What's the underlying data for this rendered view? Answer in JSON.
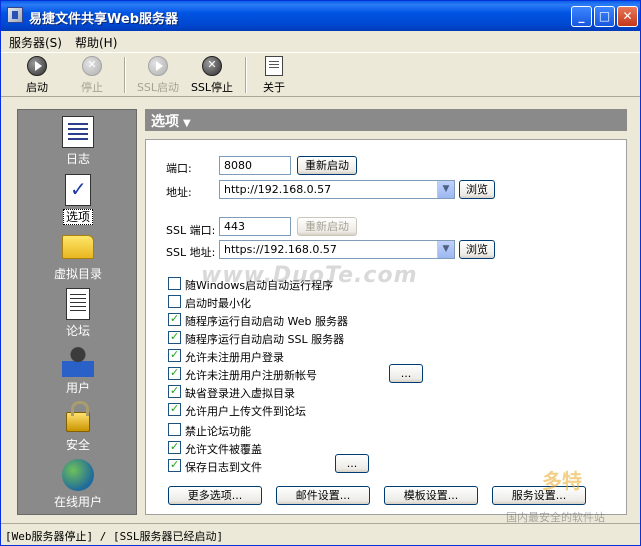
{
  "window": {
    "title": "易捷文件共享Web服务器"
  },
  "menu": [
    {
      "label": "服务器(S)"
    },
    {
      "label": "帮助(H)"
    }
  ],
  "toolbar": [
    {
      "label": "启动",
      "icon": "start-icon",
      "enabled": true
    },
    {
      "label": "停止",
      "icon": "stop-icon",
      "enabled": false
    },
    {
      "label": "SSL启动",
      "icon": "ssl-start-icon",
      "enabled": false
    },
    {
      "label": "SSL停止",
      "icon": "ssl-stop-icon",
      "enabled": true
    },
    {
      "label": "关于",
      "icon": "about-icon",
      "enabled": true
    }
  ],
  "sidebar": [
    {
      "label": "日志",
      "icon": "log-icon"
    },
    {
      "label": "选项",
      "icon": "options-icon",
      "selected": true
    },
    {
      "label": "虚拟目录",
      "icon": "folder-icon"
    },
    {
      "label": "论坛",
      "icon": "forum-icon"
    },
    {
      "label": "用户",
      "icon": "user-icon"
    },
    {
      "label": "安全",
      "icon": "lock-icon"
    },
    {
      "label": "在线用户",
      "icon": "online-users-icon"
    }
  ],
  "options": {
    "header": "选项",
    "port_label": "端口:",
    "port_value": "8080",
    "restart_label": "重新启动",
    "address_label": "地址:",
    "address_value": "http://192.168.0.57",
    "browse_label": "浏览",
    "ssl_port_label": "SSL 端口:",
    "ssl_port_value": "443",
    "ssl_restart_label": "重新启动",
    "ssl_address_label": "SSL 地址:",
    "ssl_address_value": "https://192.168.0.57",
    "ssl_browse_label": "浏览",
    "checkboxes": [
      {
        "label": "随Windows启动自动运行程序",
        "checked": false
      },
      {
        "label": "启动时最小化",
        "checked": false
      },
      {
        "label": "随程序运行自动启动 Web 服务器",
        "checked": true
      },
      {
        "label": "随程序运行自动启动 SSL 服务器",
        "checked": true
      },
      {
        "label": "允许未注册用户登录",
        "checked": true
      },
      {
        "label": "允许未注册用户注册新帐号",
        "checked": true
      },
      {
        "label": "缺省登录进入虚拟目录",
        "checked": true
      },
      {
        "label": "允许用户上传文件到论坛",
        "checked": true
      },
      {
        "label": "禁止论坛功能",
        "checked": false
      },
      {
        "label": "允许文件被覆盖",
        "checked": true
      },
      {
        "label": "保存日志到文件",
        "checked": true
      }
    ],
    "ellipsis_label": "...",
    "bottom_buttons": [
      {
        "label": "更多选项..."
      },
      {
        "label": "邮件设置..."
      },
      {
        "label": "模板设置..."
      },
      {
        "label": "服务设置..."
      }
    ]
  },
  "status": {
    "text": "[Web服务器停止] / [SSL服务器已经启动]"
  },
  "watermark": "www.DuoTe.com",
  "corner_logo": {
    "title": "多特",
    "subtitle": "国内最安全的软件站"
  }
}
